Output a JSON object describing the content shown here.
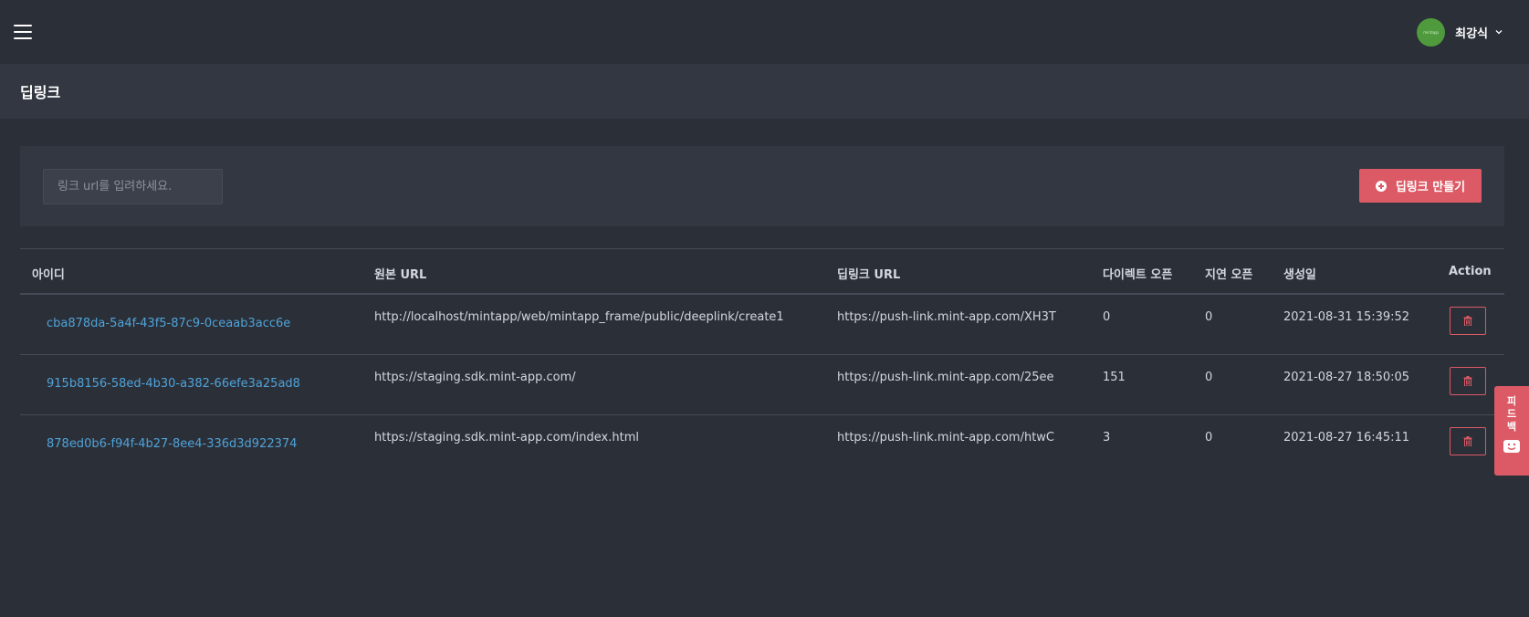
{
  "topbar": {
    "user_name": "최강식",
    "avatar_text": "mintapp"
  },
  "page": {
    "title": "딥링크"
  },
  "toolbar": {
    "search_placeholder": "링크 url를 입려하세요.",
    "create_label": "딥링크 만들기"
  },
  "table": {
    "headers": {
      "id": "아이디",
      "origin_url": "원본 URL",
      "deeplink_url": "딥링크 URL",
      "direct_open": "다이렉트 오픈",
      "deferred_open": "지연 오픈",
      "created_at": "생성일",
      "action": "Action"
    },
    "rows": [
      {
        "id": "cba878da-5a4f-43f5-87c9-0ceaab3acc6e",
        "origin_url": "http://localhost/mintapp/web/mintapp_frame/public/deeplink/create1",
        "deeplink_url": "https://push-link.mint-app.com/XH3T",
        "direct_open": "0",
        "deferred_open": "0",
        "created_at": "2021-08-31 15:39:52"
      },
      {
        "id": "915b8156-58ed-4b30-a382-66efe3a25ad8",
        "origin_url": "https://staging.sdk.mint-app.com/",
        "deeplink_url": "https://push-link.mint-app.com/25ee",
        "direct_open": "151",
        "deferred_open": "0",
        "created_at": "2021-08-27 18:50:05"
      },
      {
        "id": "878ed0b6-f94f-4b27-8ee4-336d3d922374",
        "origin_url": "https://staging.sdk.mint-app.com/index.html",
        "deeplink_url": "https://push-link.mint-app.com/htwC",
        "direct_open": "3",
        "deferred_open": "0",
        "created_at": "2021-08-27 16:45:11"
      }
    ]
  },
  "feedback": {
    "chars": [
      "피",
      "드",
      "백"
    ]
  },
  "colors": {
    "background": "#2b2f38",
    "panel": "#323741",
    "accent": "#dc5a65",
    "link": "#4fa3d9",
    "avatar": "#4f9a3c"
  }
}
